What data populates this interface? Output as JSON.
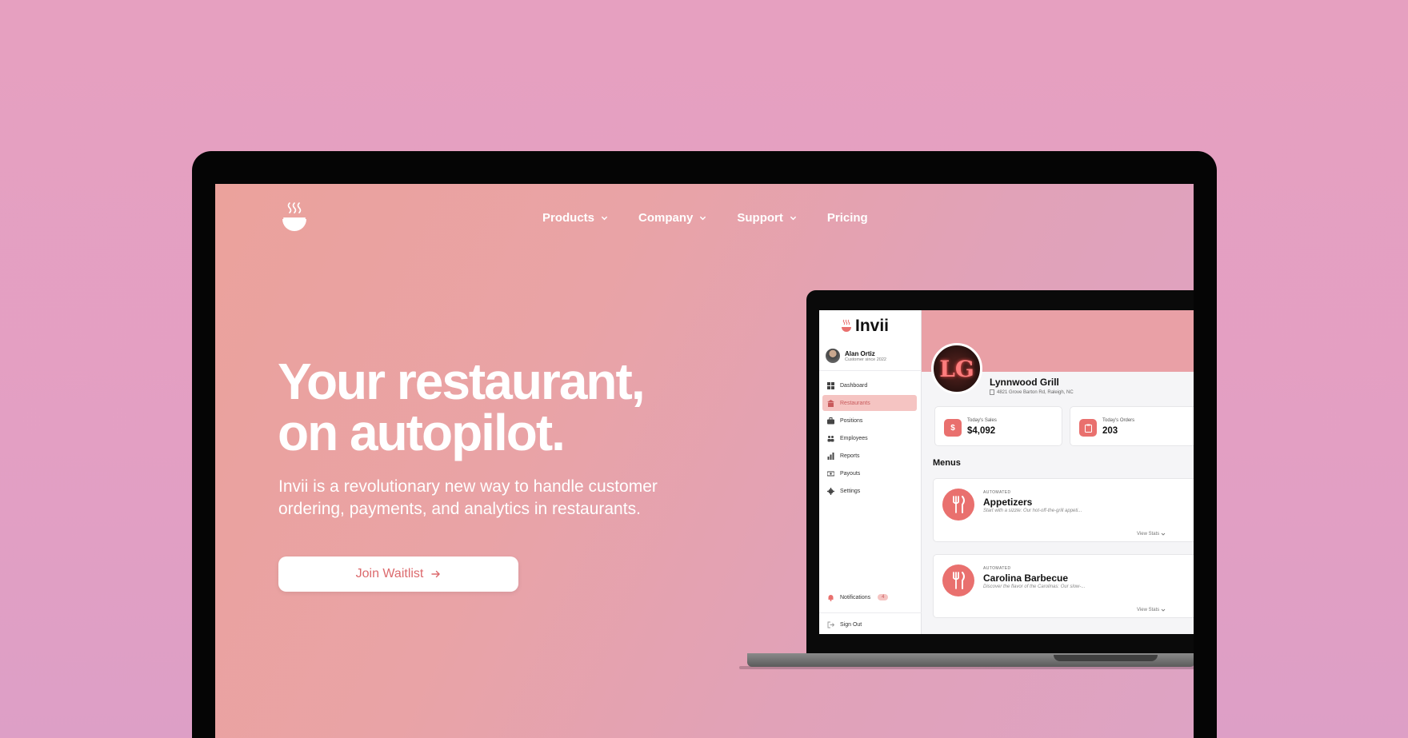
{
  "nav": {
    "items": [
      {
        "label": "Products",
        "has_dropdown": true
      },
      {
        "label": "Company",
        "has_dropdown": true
      },
      {
        "label": "Support",
        "has_dropdown": true
      },
      {
        "label": "Pricing",
        "has_dropdown": false
      }
    ]
  },
  "hero": {
    "title_line1": "Your restaurant,",
    "title_line2": "on autopilot.",
    "subtitle": "Invii is a revolutionary new way to handle customer ordering, payments, and analytics in restaurants.",
    "cta_label": "Join Waitlist",
    "cta_icon": "arrow-right-icon"
  },
  "app": {
    "brand": "Invii",
    "user": {
      "name": "Alan Ortiz",
      "since": "Customer since 2022"
    },
    "sidebar": [
      {
        "label": "Dashboard",
        "icon": "grid-icon",
        "active": false
      },
      {
        "label": "Restaurants",
        "icon": "store-icon",
        "active": true
      },
      {
        "label": "Positions",
        "icon": "briefcase-icon",
        "active": false
      },
      {
        "label": "Employees",
        "icon": "people-icon",
        "active": false
      },
      {
        "label": "Reports",
        "icon": "bar-chart-icon",
        "active": false
      },
      {
        "label": "Payouts",
        "icon": "money-icon",
        "active": false
      },
      {
        "label": "Settings",
        "icon": "gear-icon",
        "active": false
      }
    ],
    "notifications": {
      "label": "Notifications",
      "count": "4"
    },
    "sign_out": "Sign Out",
    "restaurant": {
      "logo_text": "LG",
      "name": "Lynnwood Grill",
      "address": "4821 Grove Barton Rd, Raleigh, NC"
    },
    "stats": [
      {
        "label": "Today's Sales",
        "value": "$4,092",
        "icon": "dollar-icon"
      },
      {
        "label": "Today's Orders",
        "value": "203",
        "icon": "clipboard-icon"
      }
    ],
    "menus_heading": "Menus",
    "menus": [
      {
        "tag": "AUTOMATED",
        "title": "Appetizers",
        "desc": "Start with a sizzle: Our hot-off-the-grill appeti...",
        "link": "View Stats"
      },
      {
        "tag": "AUTOMATED",
        "title": "Carolina Barbecue",
        "desc": "Discover the flavor of the Carolinas: Our slow-...",
        "link": "View Stats"
      }
    ]
  },
  "colors": {
    "background": "#e6a0c0",
    "accent": "#e9706e",
    "cta_text": "#dc6a6d",
    "bezel": "#050505"
  }
}
